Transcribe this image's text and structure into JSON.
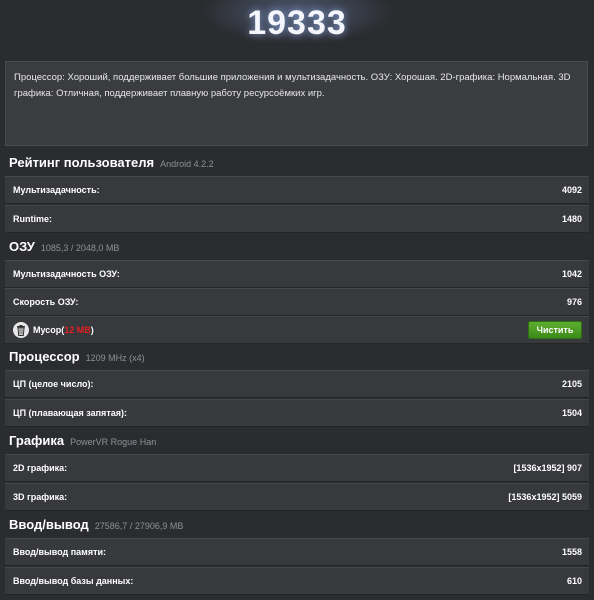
{
  "score": "19333",
  "description": "Процессор: Хороший, поддерживает большие приложения и мультизадачность. ОЗУ: Хорошая. 2D-графика: Нормальная. 3D графика: Отличная, поддерживает плавную работу ресурсоёмких игр.",
  "user_rating": {
    "title": "Рейтинг пользователя",
    "subtitle": "Android 4.2.2",
    "rows": [
      {
        "label": "Мультизадачность:",
        "value": "4092"
      },
      {
        "label": "Runtime:",
        "value": "1480"
      }
    ]
  },
  "ram": {
    "title": "ОЗУ",
    "subtitle": "1085,3 / 2048,0 MB",
    "rows": [
      {
        "label": "Мультизадачность ОЗУ:",
        "value": "1042"
      },
      {
        "label": "Скорость ОЗУ:",
        "value": "976"
      }
    ],
    "junk": {
      "label": "Мусор(",
      "amount": "12 MB",
      "close": ")",
      "icon": "trash-icon",
      "button": "Чистить",
      "button_color": "#4c9e24"
    }
  },
  "cpu": {
    "title": "Процессор",
    "subtitle": "1209 MHz (x4)",
    "rows": [
      {
        "label": "ЦП (целое число):",
        "value": "2105"
      },
      {
        "label": "ЦП (плавающая запятая):",
        "value": "1504"
      }
    ]
  },
  "graphics": {
    "title": "Графика",
    "subtitle": "PowerVR Rogue Han",
    "rows": [
      {
        "label": "2D графика:",
        "value": "[1536x1952] 907"
      },
      {
        "label": "3D графика:",
        "value": "[1536x1952] 5059"
      }
    ]
  },
  "io": {
    "title": "Ввод/вывод",
    "subtitle": "27586,7 / 27906,9 MB",
    "rows": [
      {
        "label": "Ввод/вывод памяти:",
        "value": "1558"
      },
      {
        "label": "Ввод/вывод базы данных:",
        "value": "610"
      }
    ]
  }
}
